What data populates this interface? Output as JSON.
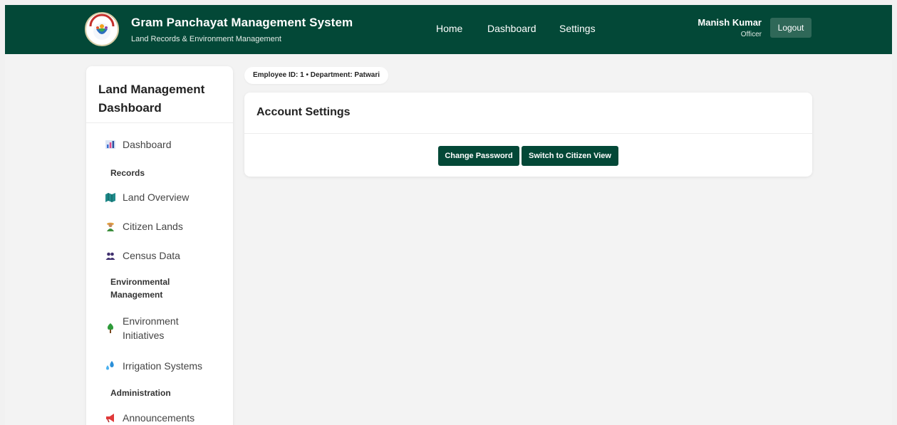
{
  "header": {
    "title": "Gram Panchayat Management System",
    "subtitle": "Land Records & Environment Management",
    "logo_text": "GRAM PANCHAYAT",
    "nav": [
      {
        "label": "Home"
      },
      {
        "label": "Dashboard"
      },
      {
        "label": "Settings"
      }
    ],
    "user": {
      "name": "Manish Kumar",
      "role": "Officer"
    },
    "logout_label": "Logout"
  },
  "sidebar": {
    "title": "Land Management Dashboard",
    "items": [
      {
        "type": "item",
        "label": "Dashboard",
        "icon": "bar-chart-icon"
      },
      {
        "type": "section",
        "label": "Records"
      },
      {
        "type": "item",
        "label": "Land Overview",
        "icon": "map-icon"
      },
      {
        "type": "item",
        "label": "Citizen Lands",
        "icon": "farmer-icon"
      },
      {
        "type": "item",
        "label": "Census Data",
        "icon": "people-icon"
      },
      {
        "type": "section",
        "label": "Environmental Management"
      },
      {
        "type": "item",
        "label": "Environment Initiatives",
        "icon": "tree-icon"
      },
      {
        "type": "item",
        "label": "Irrigation Systems",
        "icon": "droplets-icon"
      },
      {
        "type": "section",
        "label": "Administration"
      },
      {
        "type": "item",
        "label": "Announcements",
        "icon": "megaphone-icon"
      }
    ]
  },
  "employee_info": "Employee ID: 1 • Department: Patwari",
  "account_settings": {
    "title": "Account Settings",
    "change_password_label": "Change Password",
    "switch_view_label": "Switch to Citizen View"
  },
  "colors": {
    "header_bg": "#034837",
    "button_bg": "#034837",
    "logout_bg": "#2f6858",
    "page_bg": "#f3f3f3"
  }
}
